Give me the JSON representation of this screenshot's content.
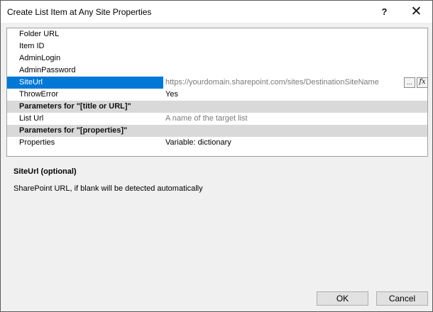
{
  "window": {
    "title": "Create List Item at Any Site Properties"
  },
  "titlebar": {
    "help_glyph": "?",
    "close_glyph": "✕"
  },
  "grid": {
    "rows": [
      {
        "name": "Folder URL",
        "value": ""
      },
      {
        "name": "Item ID",
        "value": ""
      },
      {
        "name": "AdminLogin",
        "value": ""
      },
      {
        "name": "AdminPassword",
        "value": ""
      },
      {
        "name": "SiteUrl",
        "value": "https://yourdomain.sharepoint.com/sites/DestinationSiteName",
        "selected": true,
        "placeholder": true
      },
      {
        "name": "ThrowError",
        "value": "Yes"
      },
      {
        "category": "Parameters for \"[title or URL]\""
      },
      {
        "name": "List Url",
        "value": "A name of the target list",
        "placeholder": true
      },
      {
        "category": "Parameters for \"[properties]\""
      },
      {
        "name": "Properties",
        "value": "Variable: dictionary"
      }
    ],
    "ellipsis_label": "...",
    "fx_label": "fx"
  },
  "description": {
    "title": "SiteUrl (optional)",
    "text": "SharePoint URL, if blank will be detected automatically"
  },
  "buttons": {
    "ok": "OK",
    "cancel": "Cancel"
  },
  "colors": {
    "selection": "#0078d7",
    "category_bg": "#d9d9d9",
    "placeholder_text": "#7a7a7a"
  }
}
